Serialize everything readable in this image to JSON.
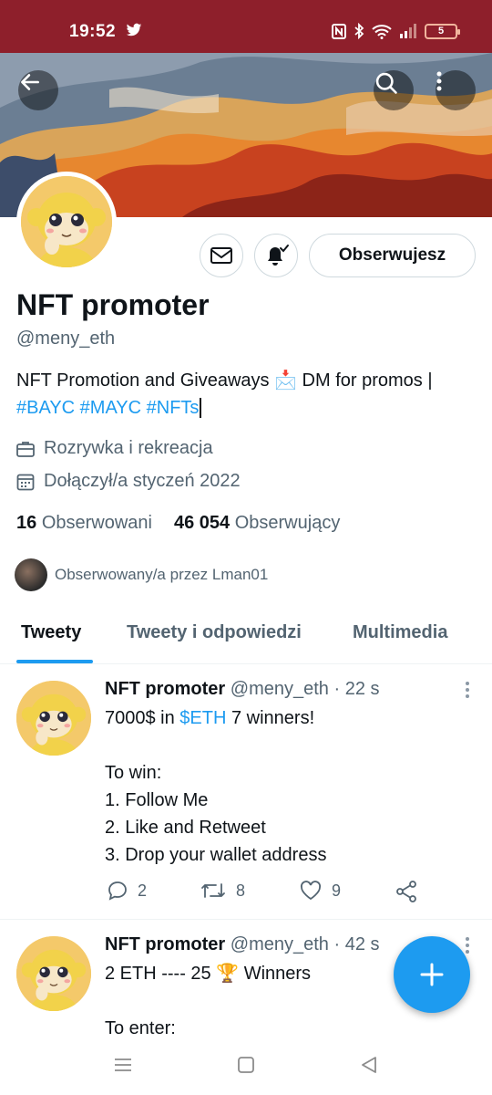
{
  "status_bar": {
    "time": "19:52",
    "battery": "5",
    "icons": [
      "twitter-icon",
      "nfc-icon",
      "bluetooth-icon",
      "wifi-icon",
      "signal-icon",
      "battery-icon"
    ]
  },
  "header": {
    "icons": [
      "back-arrow-icon",
      "search-icon",
      "more-vertical-icon"
    ]
  },
  "profile": {
    "name": "NFT promoter",
    "handle": "@meny_eth",
    "follow_button_label": "Obserwujesz",
    "bio_text": "NFT Promotion and Giveaways 📩 DM for promos |",
    "bio_hashtags": "#BAYC #MAYC #NFTs",
    "category": "Rozrywka i rekreacja",
    "joined": "Dołączył/a styczeń 2022",
    "following_count": "16",
    "following_label": "Obserwowani",
    "followers_count": "46 054",
    "followers_label": "Obserwujący",
    "followed_by": "Obserwowany/a przez Lman01"
  },
  "tabs": [
    {
      "label": "Tweety",
      "active": true
    },
    {
      "label": "Tweety i odpowiedzi",
      "active": false
    },
    {
      "label": "Multimedia",
      "active": false
    }
  ],
  "tweets": [
    {
      "name": "NFT promoter",
      "handle": "@meny_eth",
      "time": "· 22 s",
      "text_prefix": "7000$ in ",
      "text_link": "$ETH",
      "text_suffix": " 7 winners!",
      "text_rest": "To win:\n1. Follow Me\n2. Like and Retweet\n3. Drop your wallet address",
      "replies": "2",
      "retweets": "8",
      "likes": "9"
    },
    {
      "name": "NFT promoter",
      "handle": "@meny_eth",
      "time": "· 42 s",
      "text_first": "2 ETH ---- 25 🏆 Winners",
      "text_rest": "To enter:"
    }
  ],
  "colors": {
    "status_bar": "#8e1f2b",
    "accent": "#1d9bf0",
    "secondary_text": "#536471"
  }
}
